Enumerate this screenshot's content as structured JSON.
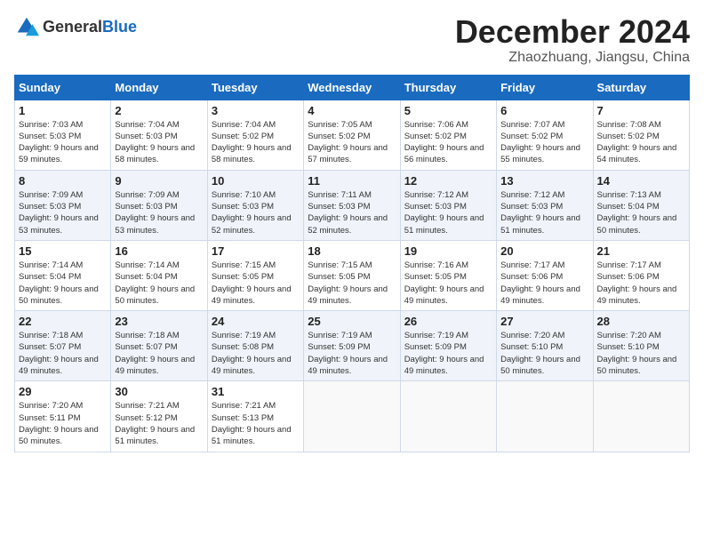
{
  "header": {
    "logo_general": "General",
    "logo_blue": "Blue",
    "month_title": "December 2024",
    "subtitle": "Zhaozhuang, Jiangsu, China"
  },
  "weekdays": [
    "Sunday",
    "Monday",
    "Tuesday",
    "Wednesday",
    "Thursday",
    "Friday",
    "Saturday"
  ],
  "weeks": [
    [
      {
        "day": "1",
        "sunrise": "7:03 AM",
        "sunset": "5:03 PM",
        "daylight": "9 hours and 59 minutes."
      },
      {
        "day": "2",
        "sunrise": "7:04 AM",
        "sunset": "5:03 PM",
        "daylight": "9 hours and 58 minutes."
      },
      {
        "day": "3",
        "sunrise": "7:04 AM",
        "sunset": "5:02 PM",
        "daylight": "9 hours and 58 minutes."
      },
      {
        "day": "4",
        "sunrise": "7:05 AM",
        "sunset": "5:02 PM",
        "daylight": "9 hours and 57 minutes."
      },
      {
        "day": "5",
        "sunrise": "7:06 AM",
        "sunset": "5:02 PM",
        "daylight": "9 hours and 56 minutes."
      },
      {
        "day": "6",
        "sunrise": "7:07 AM",
        "sunset": "5:02 PM",
        "daylight": "9 hours and 55 minutes."
      },
      {
        "day": "7",
        "sunrise": "7:08 AM",
        "sunset": "5:02 PM",
        "daylight": "9 hours and 54 minutes."
      }
    ],
    [
      {
        "day": "8",
        "sunrise": "7:09 AM",
        "sunset": "5:03 PM",
        "daylight": "9 hours and 53 minutes."
      },
      {
        "day": "9",
        "sunrise": "7:09 AM",
        "sunset": "5:03 PM",
        "daylight": "9 hours and 53 minutes."
      },
      {
        "day": "10",
        "sunrise": "7:10 AM",
        "sunset": "5:03 PM",
        "daylight": "9 hours and 52 minutes."
      },
      {
        "day": "11",
        "sunrise": "7:11 AM",
        "sunset": "5:03 PM",
        "daylight": "9 hours and 52 minutes."
      },
      {
        "day": "12",
        "sunrise": "7:12 AM",
        "sunset": "5:03 PM",
        "daylight": "9 hours and 51 minutes."
      },
      {
        "day": "13",
        "sunrise": "7:12 AM",
        "sunset": "5:03 PM",
        "daylight": "9 hours and 51 minutes."
      },
      {
        "day": "14",
        "sunrise": "7:13 AM",
        "sunset": "5:04 PM",
        "daylight": "9 hours and 50 minutes."
      }
    ],
    [
      {
        "day": "15",
        "sunrise": "7:14 AM",
        "sunset": "5:04 PM",
        "daylight": "9 hours and 50 minutes."
      },
      {
        "day": "16",
        "sunrise": "7:14 AM",
        "sunset": "5:04 PM",
        "daylight": "9 hours and 50 minutes."
      },
      {
        "day": "17",
        "sunrise": "7:15 AM",
        "sunset": "5:05 PM",
        "daylight": "9 hours and 49 minutes."
      },
      {
        "day": "18",
        "sunrise": "7:15 AM",
        "sunset": "5:05 PM",
        "daylight": "9 hours and 49 minutes."
      },
      {
        "day": "19",
        "sunrise": "7:16 AM",
        "sunset": "5:05 PM",
        "daylight": "9 hours and 49 minutes."
      },
      {
        "day": "20",
        "sunrise": "7:17 AM",
        "sunset": "5:06 PM",
        "daylight": "9 hours and 49 minutes."
      },
      {
        "day": "21",
        "sunrise": "7:17 AM",
        "sunset": "5:06 PM",
        "daylight": "9 hours and 49 minutes."
      }
    ],
    [
      {
        "day": "22",
        "sunrise": "7:18 AM",
        "sunset": "5:07 PM",
        "daylight": "9 hours and 49 minutes."
      },
      {
        "day": "23",
        "sunrise": "7:18 AM",
        "sunset": "5:07 PM",
        "daylight": "9 hours and 49 minutes."
      },
      {
        "day": "24",
        "sunrise": "7:19 AM",
        "sunset": "5:08 PM",
        "daylight": "9 hours and 49 minutes."
      },
      {
        "day": "25",
        "sunrise": "7:19 AM",
        "sunset": "5:09 PM",
        "daylight": "9 hours and 49 minutes."
      },
      {
        "day": "26",
        "sunrise": "7:19 AM",
        "sunset": "5:09 PM",
        "daylight": "9 hours and 49 minutes."
      },
      {
        "day": "27",
        "sunrise": "7:20 AM",
        "sunset": "5:10 PM",
        "daylight": "9 hours and 50 minutes."
      },
      {
        "day": "28",
        "sunrise": "7:20 AM",
        "sunset": "5:10 PM",
        "daylight": "9 hours and 50 minutes."
      }
    ],
    [
      {
        "day": "29",
        "sunrise": "7:20 AM",
        "sunset": "5:11 PM",
        "daylight": "9 hours and 50 minutes."
      },
      {
        "day": "30",
        "sunrise": "7:21 AM",
        "sunset": "5:12 PM",
        "daylight": "9 hours and 51 minutes."
      },
      {
        "day": "31",
        "sunrise": "7:21 AM",
        "sunset": "5:13 PM",
        "daylight": "9 hours and 51 minutes."
      },
      null,
      null,
      null,
      null
    ]
  ]
}
